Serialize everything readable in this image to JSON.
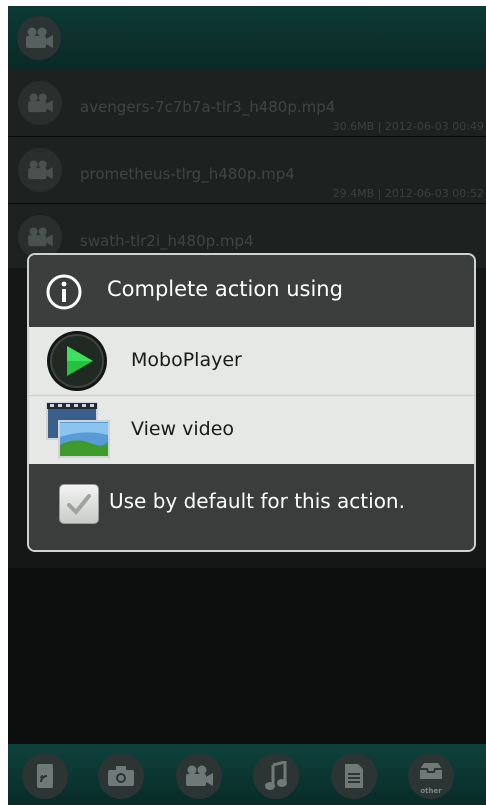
{
  "files": [
    {
      "name": "avengers-7c7b7a-tlr3_h480p.mp4",
      "meta": "30.6MB | 2012-06-03  00:49"
    },
    {
      "name": "prometheus-tlrg_h480p.mp4",
      "meta": "29.4MB | 2012-06-03  00:52"
    },
    {
      "name": "swath-tlr2i_h480p.mp4",
      "meta": ""
    }
  ],
  "dialog": {
    "title": "Complete action using",
    "options": [
      {
        "label": "MoboPlayer"
      },
      {
        "label": "View video"
      }
    ],
    "default_label": "Use by default for this action.",
    "default_checked": true
  },
  "bottom_nav": {
    "items": [
      "apk-icon",
      "camera-icon",
      "video-icon",
      "music-icon",
      "document-icon",
      "other-icon"
    ],
    "other_label": "other"
  },
  "colors": {
    "accent": "#0f423d",
    "dialog_bg": "#3a3d3b",
    "option_bg": "#e6e8e6"
  }
}
